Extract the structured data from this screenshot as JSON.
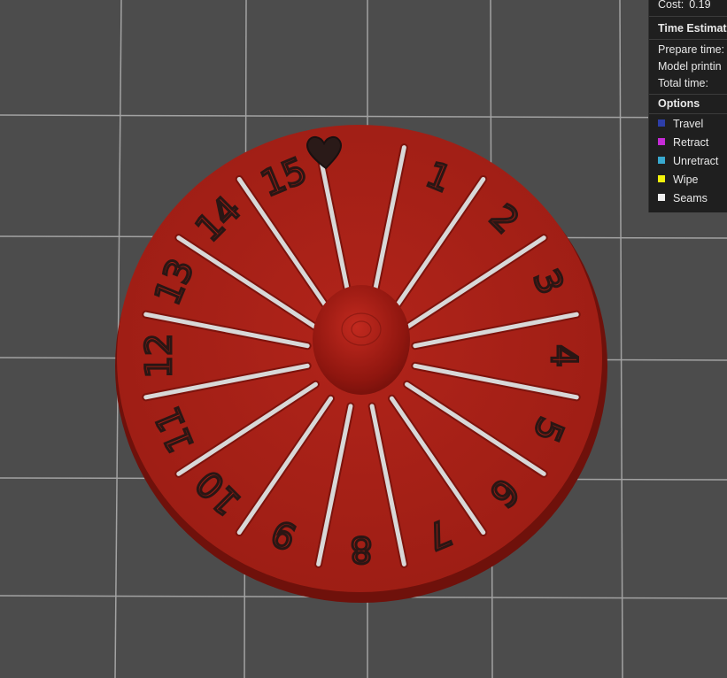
{
  "legend": {
    "cost_label": "Cost:",
    "cost_value": "0.19",
    "time_header": "Time Estimat",
    "time_rows": [
      "Prepare time:",
      "Model printin",
      "Total time:"
    ],
    "options_header": "Options",
    "options": [
      {
        "label": "Travel",
        "color": "#2d3ea8",
        "icon": "travel-swatch"
      },
      {
        "label": "Retract",
        "color": "#c52bd6",
        "icon": "retract-swatch"
      },
      {
        "label": "Unretract",
        "color": "#38a9cf",
        "icon": "unretract-swatch"
      },
      {
        "label": "Wipe",
        "color": "#f2f20c",
        "icon": "wipe-swatch"
      },
      {
        "label": "Seams",
        "color": "#f0f0f0",
        "icon": "seams-swatch"
      }
    ]
  },
  "model": {
    "numbers": [
      "1",
      "2",
      "3",
      "4",
      "5",
      "6",
      "7",
      "8",
      "9",
      "10",
      "11",
      "12",
      "13",
      "14",
      "15"
    ],
    "top_symbol": "heart",
    "body_color": "#a11b12",
    "ridge_color": "#d8d8d8",
    "background": "#4c4c4c",
    "grid_color": "#9a9a9a"
  }
}
